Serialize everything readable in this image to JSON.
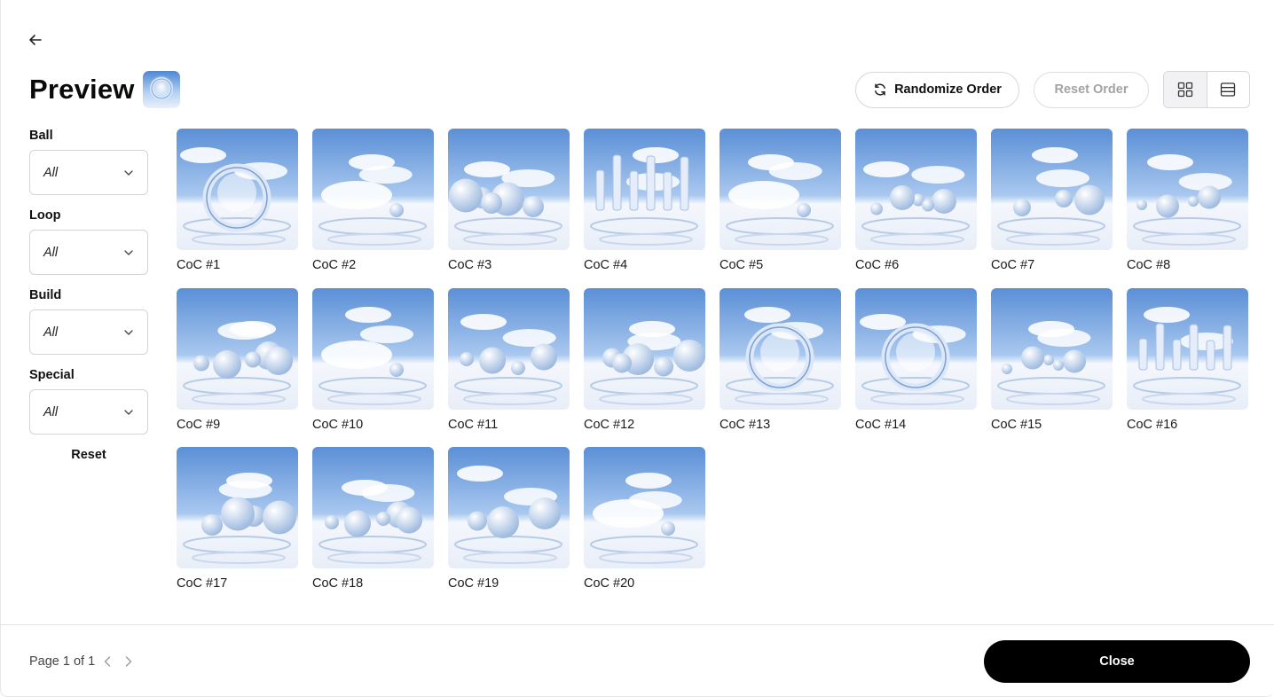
{
  "header": {
    "back_icon": "arrow-left-icon",
    "title": "Preview",
    "title_thumb_icon": "collection-thumbnail"
  },
  "toolbar": {
    "randomize_label": "Randomize Order",
    "randomize_icon": "refresh-icon",
    "reset_order_label": "Reset Order",
    "view_grid_icon": "grid-view-icon",
    "view_list_icon": "list-view-icon",
    "active_view": "grid"
  },
  "filters": [
    {
      "label": "Ball",
      "value": "All"
    },
    {
      "label": "Loop",
      "value": "All"
    },
    {
      "label": "Build",
      "value": "All"
    },
    {
      "label": "Special",
      "value": "All"
    }
  ],
  "filters_reset_label": "Reset",
  "items": [
    {
      "label": "CoC #1",
      "variant": "ring"
    },
    {
      "label": "CoC #2",
      "variant": "clouds"
    },
    {
      "label": "CoC #3",
      "variant": "spheres"
    },
    {
      "label": "CoC #4",
      "variant": "city"
    },
    {
      "label": "CoC #5",
      "variant": "clouds"
    },
    {
      "label": "CoC #6",
      "variant": "spheres"
    },
    {
      "label": "CoC #7",
      "variant": "spheres"
    },
    {
      "label": "CoC #8",
      "variant": "spheres"
    },
    {
      "label": "CoC #9",
      "variant": "spheres"
    },
    {
      "label": "CoC #10",
      "variant": "clouds"
    },
    {
      "label": "CoC #11",
      "variant": "spheres"
    },
    {
      "label": "CoC #12",
      "variant": "spheres"
    },
    {
      "label": "CoC #13",
      "variant": "ring"
    },
    {
      "label": "CoC #14",
      "variant": "ring"
    },
    {
      "label": "CoC #15",
      "variant": "spheres"
    },
    {
      "label": "CoC #16",
      "variant": "city"
    },
    {
      "label": "CoC #17",
      "variant": "spheres"
    },
    {
      "label": "CoC #18",
      "variant": "spheres"
    },
    {
      "label": "CoC #19",
      "variant": "spheres"
    },
    {
      "label": "CoC #20",
      "variant": "clouds"
    }
  ],
  "footer": {
    "page_text": "Page 1 of 1",
    "prev_icon": "chevron-left-icon",
    "next_icon": "chevron-right-icon",
    "close_label": "Close"
  },
  "colors": {
    "sky_top": "#5b8fd6",
    "sky_mid": "#a9c8ef",
    "ground": "#e8eef8",
    "accent_black": "#000000",
    "border": "#d7d7d7"
  }
}
